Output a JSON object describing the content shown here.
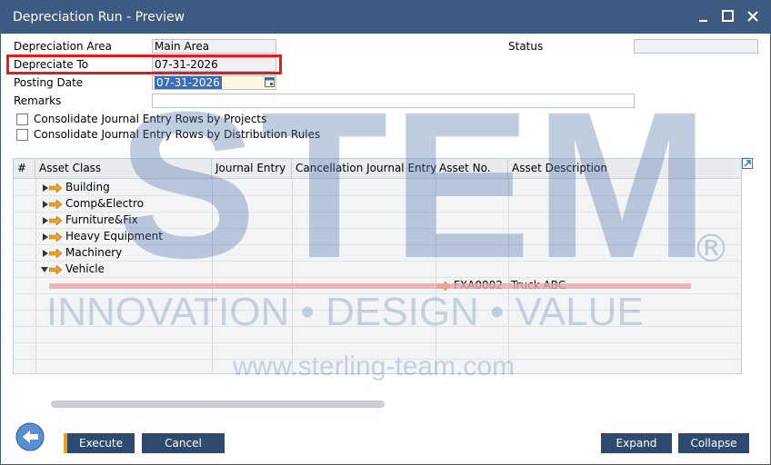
{
  "window": {
    "title": "Depreciation Run - Preview"
  },
  "form": {
    "depreciation_area_label": "Depreciation Area",
    "depreciation_area_value": "Main Area",
    "depreciate_to_label": "Depreciate To",
    "depreciate_to_value": "07-31-2026",
    "posting_date_label": "Posting Date",
    "posting_date_value": "07-31-2026",
    "remarks_label": "Remarks",
    "remarks_value": "",
    "status_label": "Status",
    "status_value": "",
    "consolidate_projects_label": "Consolidate Journal Entry Rows by Projects",
    "consolidate_distribution_label": "Consolidate Journal Entry Rows by Distribution Rules"
  },
  "grid": {
    "headers": [
      "#",
      "Asset Class",
      "Journal Entry",
      "Cancellation Journal Entry",
      "Asset No.",
      "Asset Description"
    ],
    "groups": [
      {
        "label": "Building",
        "expanded": false
      },
      {
        "label": "Comp&Electro",
        "expanded": false
      },
      {
        "label": "Furniture&Fix",
        "expanded": false
      },
      {
        "label": "Heavy Equipment",
        "expanded": false
      },
      {
        "label": "Machinery",
        "expanded": false
      },
      {
        "label": "Vehicle",
        "expanded": true
      }
    ],
    "item": {
      "asset_no": "FXA0002",
      "asset_description": "Truck ABC"
    }
  },
  "buttons": {
    "execute": "Execute",
    "cancel": "Cancel",
    "expand": "Expand",
    "collapse": "Collapse"
  },
  "watermark": {
    "stem": "STEM",
    "registered": "®",
    "tagline": "INNOVATION • DESIGN • VALUE",
    "url": "www.sterling-team.com"
  },
  "colors": {
    "titlebar": "#3d5a80",
    "button": "#2f4a6d",
    "highlight_border": "#e21b1b",
    "arrow": "#e8a22c"
  }
}
